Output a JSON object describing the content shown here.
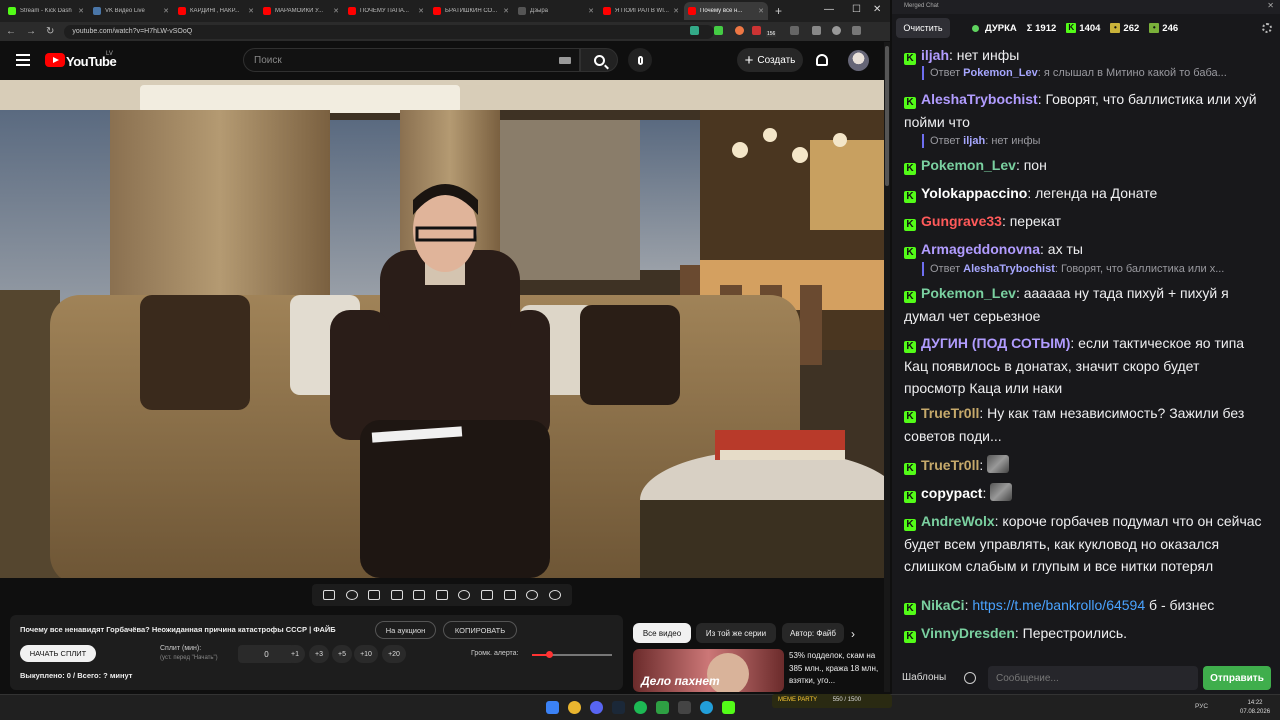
{
  "browser": {
    "tabs": [
      {
        "title": "Stream - Kick Dash",
        "color": "#53fc18"
      },
      {
        "title": "VK Видео Live",
        "color": "#4a76a8"
      },
      {
        "title": "КАРДИНГ, НАКР...",
        "color": "#ff0000"
      },
      {
        "title": "МАРАМОЙКИ У...",
        "color": "#ff0000"
      },
      {
        "title": "ПОЧЕМУ ПАПА...",
        "color": "#ff0000"
      },
      {
        "title": "БРАТИШКИН СО...",
        "color": "#ff0000"
      },
      {
        "title": "Дзыра",
        "color": "#555555"
      },
      {
        "title": "Я ПОИГРАЛ В WI...",
        "color": "#ff0000"
      },
      {
        "title": "Почему все н...",
        "color": "#ff0000"
      }
    ],
    "url": "youtube.com/watch?v=H7hLW-vSOoQ",
    "ext_badge": "156"
  },
  "youtube": {
    "logo_text": "YouTube",
    "country": "LV",
    "search_placeholder": "Поиск",
    "create_label": "Создать"
  },
  "panel": {
    "video_title": "Почему все ненавидят Горбачёва? Неожиданная причина катастрофы СССР | ФАЙБ",
    "auction_label": "На аукцион",
    "copy_label": "КОПИРОВАТЬ",
    "start_split_label": "НАЧАТЬ СПЛИТ",
    "split_label": "Сплит (мин):",
    "split_sub": "(уст. перед \"Начать\")",
    "split_value": "0",
    "increments": [
      "+1",
      "+3",
      "+5",
      "+10",
      "+20"
    ],
    "volume_label": "Громк. алерта:",
    "volume_level": 0.2,
    "bought": "Выкуплено: 0 / Всего: ? минут"
  },
  "recommendations": {
    "chips": [
      "Все видео",
      "Из той же серии",
      "Автор: Файб"
    ],
    "thumb_text": "Дело пахнет",
    "title": "53% подделок, скам на 385 млн., кража 18 млн, взятки, уго..."
  },
  "chat": {
    "window_title": "Merged Chat",
    "clear_label": "Очистить",
    "channel": "ДУРКА",
    "total": "Σ 1912",
    "kick_count": "1404",
    "stat2": "262",
    "stat3": "246",
    "messages": [
      {
        "user": "iljah",
        "color": "#b19cff",
        "text": "нет инфы"
      },
      {
        "reply_user": "Pokemon_Lev",
        "reply_text": "я слышал в Митино какой то баба..."
      },
      {
        "user": "AleshaTrybochist",
        "color": "#b19cff",
        "text": "Говорят, что баллистика или хуй пойми что"
      },
      {
        "reply_user": "iljah",
        "reply_text": "нет инфы"
      },
      {
        "user": "Pokemon_Lev",
        "color": "#7ad0a0",
        "text": "пон"
      },
      {
        "user": "Yolokappaccino",
        "color": "#ffffff",
        "text": "легенда на Донате"
      },
      {
        "user": "Gungrave33",
        "color": "#ff5a5a",
        "text": "перекат"
      },
      {
        "user": "Armageddonovna",
        "color": "#b19cff",
        "text": "ах ты"
      },
      {
        "reply_user": "AleshaTrybochist",
        "reply_text": "Говорят, что баллистика или х..."
      },
      {
        "user": "Pokemon_Lev",
        "color": "#7ad0a0",
        "text": "аааааа ну тада пихуй + пихуй я думал чет серьезное"
      },
      {
        "user": "ДУГИН (ПОД СОТЫМ)",
        "color": "#b19cff",
        "text": "если тактическое яо типа Кац появилось в донатах, значит скоро будет просмотр Каца или наки"
      },
      {
        "user": "TrueTr0ll",
        "color": "#c6a96b",
        "text": "Ну как там независимость? Зажили без советов поди..."
      },
      {
        "user": "TrueTr0ll",
        "color": "#c6a96b",
        "text": ""
      },
      {
        "user": "copypact",
        "color": "#ffffff",
        "text": ""
      },
      {
        "user": "AndreWolx",
        "color": "#7ad0a0",
        "text": "короче горбачев подумал что он сейчас будет всем управлять, как кукловод но оказался слишком слабым и глупым и все нитки потерял"
      },
      {
        "user": "NikaCi",
        "color": "#7ad0a0",
        "text": "https://t.me/bankrollo/64594",
        "suffix": " б - бизнес"
      },
      {
        "user": "VinnyDresden",
        "color": "#7ad0a0",
        "text": "Перестроились."
      }
    ],
    "templates_label": "Шаблоны",
    "input_placeholder": "Сообщение...",
    "send_label": "Отправить"
  },
  "taskbar": {
    "lang": "РУС",
    "time": "14:22",
    "date": "07.08.2026",
    "meme_label": "MEME PARTY",
    "meme_count": "550 / 1500"
  }
}
